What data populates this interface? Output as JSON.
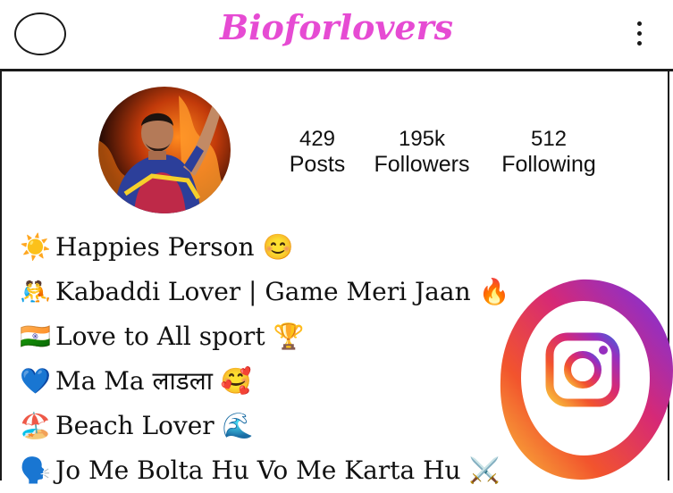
{
  "header": {
    "title": "Bioforlovers",
    "menu_icon": "kebab-menu-icon",
    "left_icon": "circle-icon"
  },
  "profile": {
    "avatar_icon": "profile-avatar",
    "stats": [
      {
        "value": "429",
        "label": "Posts"
      },
      {
        "value": "195k",
        "label": "Followers"
      },
      {
        "value": "512",
        "label": "Following"
      }
    ]
  },
  "bio": [
    {
      "emoji": "☀️",
      "text": "Happies Person 😊"
    },
    {
      "emoji": "🤼",
      "text": "Kabaddi Lover | Game Meri Jaan 🔥"
    },
    {
      "emoji": "🇮🇳",
      "text": "Love to All sport 🏆"
    },
    {
      "emoji": "💙",
      "text": "Ma Ma लाडला 🥰"
    },
    {
      "emoji": "🏖️",
      "text": "Beach Lover 🌊"
    },
    {
      "emoji": "🗣️",
      "text": "Jo Me Bolta Hu Vo Me Karta Hu ⚔️"
    }
  ],
  "colors": {
    "brand": "#e64bd3",
    "ig_gradient": [
      "#f9c23c",
      "#f2542d",
      "#d62976",
      "#962fbf",
      "#4f5bd5"
    ]
  },
  "decor": {
    "instagram_logo": "instagram-logo-icon"
  }
}
